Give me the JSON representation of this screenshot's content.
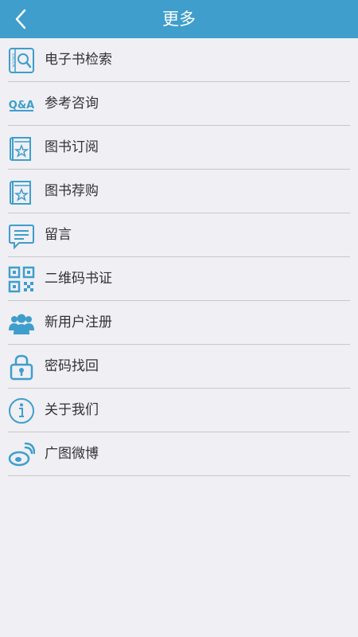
{
  "header": {
    "title": "更多",
    "back_icon": "chevron-left-icon"
  },
  "colors": {
    "header_bg": "#3f9ecb",
    "icon_blue": "#3f9ecb",
    "background": "#efeff4",
    "divider": "#c9c9c9"
  },
  "menu": {
    "items": [
      {
        "label": "电子书检索",
        "icon": "ebook-search-icon",
        "icon_text": "EBOOK"
      },
      {
        "label": "参考咨询",
        "icon": "qa-icon",
        "icon_text": "Q&A"
      },
      {
        "label": "图书订阅",
        "icon": "book-star-icon"
      },
      {
        "label": "图书荐购",
        "icon": "book-star-icon"
      },
      {
        "label": "留言",
        "icon": "message-icon"
      },
      {
        "label": "二维码书证",
        "icon": "qr-code-icon"
      },
      {
        "label": "新用户注册",
        "icon": "users-icon"
      },
      {
        "label": "密码找回",
        "icon": "lock-icon"
      },
      {
        "label": "关于我们",
        "icon": "info-icon"
      },
      {
        "label": "广图微博",
        "icon": "weibo-icon"
      }
    ]
  }
}
